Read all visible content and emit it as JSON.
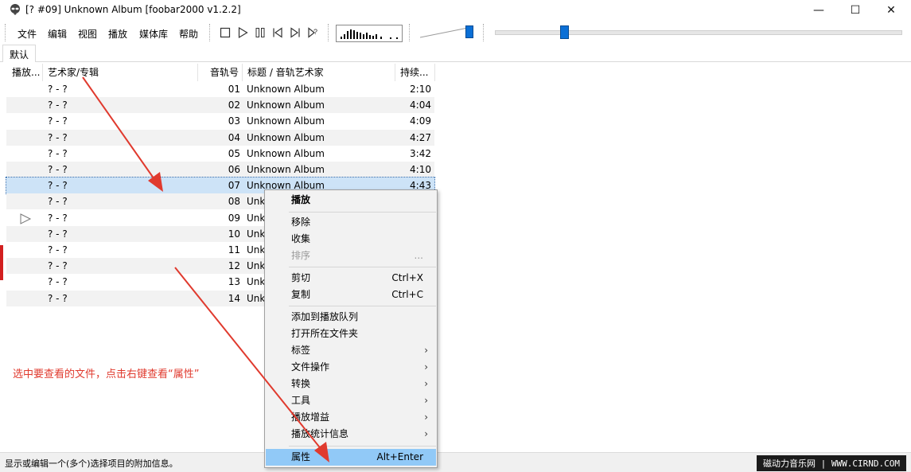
{
  "window": {
    "title": "[? #09] Unknown Album   [foobar2000 v1.2.2]",
    "minimize_glyph": "—",
    "maximize_glyph": "☐",
    "close_glyph": "✕"
  },
  "menubar": [
    "文件",
    "编辑",
    "视图",
    "播放",
    "媒体库",
    "帮助"
  ],
  "tabs": [
    "默认"
  ],
  "columns": [
    "播放...",
    "艺术家/专辑",
    "音轨号",
    "标题 / 音轨艺术家",
    "持续..."
  ],
  "rows": [
    {
      "artist": "? - ?",
      "track": "01",
      "title": "Unknown Album",
      "duration": "2:10"
    },
    {
      "artist": "? - ?",
      "track": "02",
      "title": "Unknown Album",
      "duration": "4:04"
    },
    {
      "artist": "? - ?",
      "track": "03",
      "title": "Unknown Album",
      "duration": "4:09"
    },
    {
      "artist": "? - ?",
      "track": "04",
      "title": "Unknown Album",
      "duration": "4:27"
    },
    {
      "artist": "? - ?",
      "track": "05",
      "title": "Unknown Album",
      "duration": "3:42"
    },
    {
      "artist": "? - ?",
      "track": "06",
      "title": "Unknown Album",
      "duration": "4:10"
    },
    {
      "artist": "? - ?",
      "track": "07",
      "title": "Unknown Album",
      "duration": "4:43"
    },
    {
      "artist": "? - ?",
      "track": "08",
      "title": "Unk",
      "duration": ""
    },
    {
      "artist": "? - ?",
      "track": "09",
      "title": "Unk",
      "duration": ""
    },
    {
      "artist": "? - ?",
      "track": "10",
      "title": "Unk",
      "duration": ""
    },
    {
      "artist": "? - ?",
      "track": "11",
      "title": "Unk",
      "duration": ""
    },
    {
      "artist": "? - ?",
      "track": "12",
      "title": "Unk",
      "duration": ""
    },
    {
      "artist": "? - ?",
      "track": "13",
      "title": "Unk",
      "duration": ""
    },
    {
      "artist": "? - ?",
      "track": "14",
      "title": "Unk",
      "duration": ""
    }
  ],
  "selected_track": "07",
  "playing_track": "09",
  "context_menu": {
    "play": "播放",
    "remove": "移除",
    "collect": "收集",
    "sort": "排序",
    "sort_more": "...",
    "cut": "剪切",
    "cut_shortcut": "Ctrl+X",
    "copy": "复制",
    "copy_shortcut": "Ctrl+C",
    "add_queue": "添加到播放队列",
    "open_folder": "打开所在文件夹",
    "tags": "标签",
    "file_ops": "文件操作",
    "convert": "转换",
    "tools": "工具",
    "replaygain": "播放增益",
    "stats": "播放统计信息",
    "properties": "属性",
    "properties_shortcut": "Alt+Enter",
    "submenu_arrow": "›"
  },
  "annotation": "选中要查看的文件，点击右键查看“属性”",
  "status_text": "显示或编辑一个(多个)选择项目的附加信息。",
  "watermark": "磁动力音乐网 | WWW.CIRND.COM",
  "seek_position": 0.16,
  "volume_level": 0.9,
  "accent_color": "#0a6fd6",
  "annotation_color": "#e03a2e"
}
